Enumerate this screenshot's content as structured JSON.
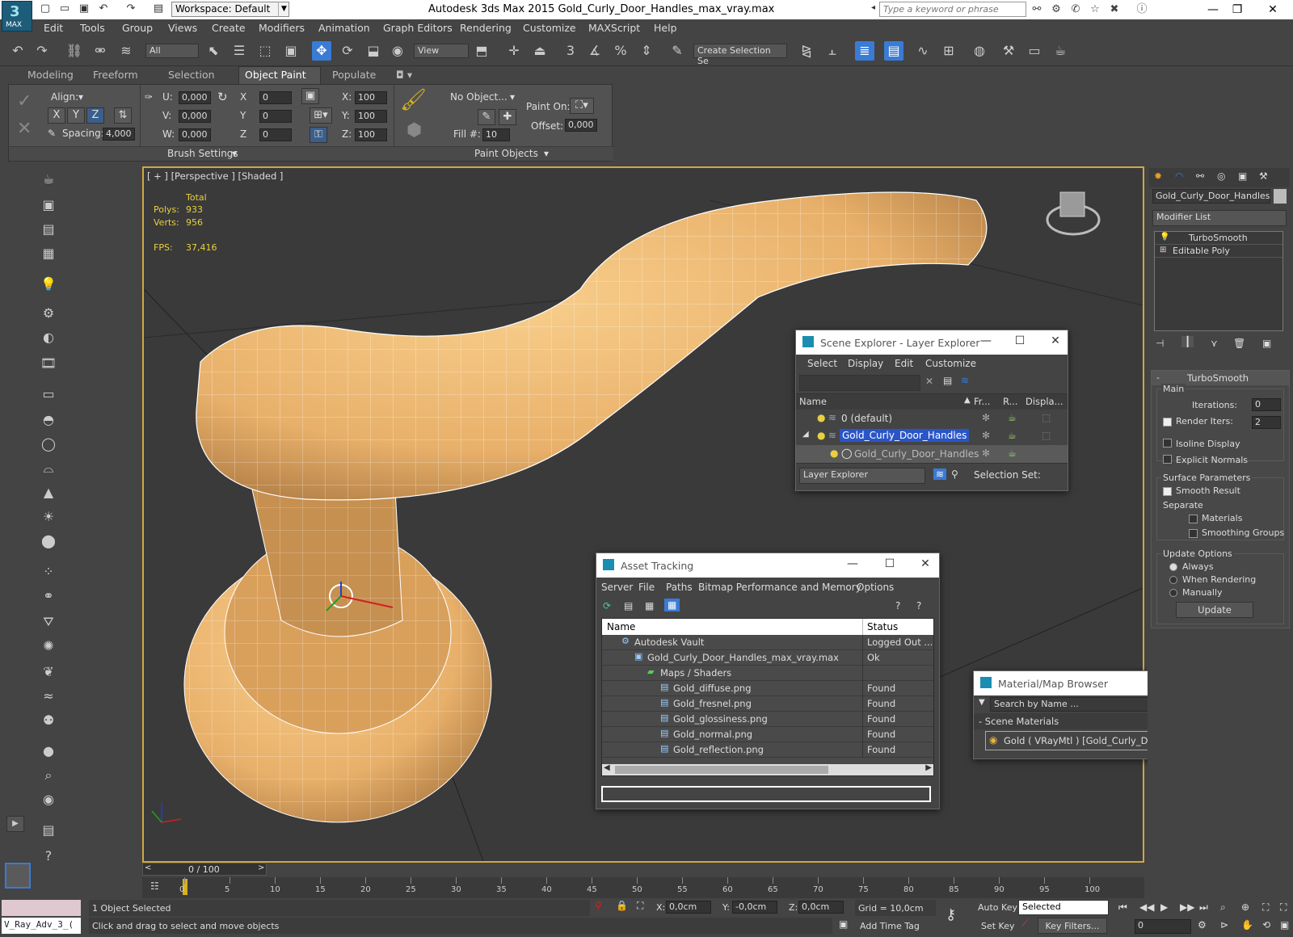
{
  "app": {
    "logo": "MAX",
    "title": "Autodesk 3ds Max  2015     Gold_Curly_Door_Handles_max_vray.max",
    "workspace": "Workspace: Default",
    "search_placeholder": "Type a keyword or phrase"
  },
  "menu": [
    "Edit",
    "Tools",
    "Group",
    "Views",
    "Create",
    "Modifiers",
    "Animation",
    "Graph Editors",
    "Rendering",
    "Customize",
    "MAXScript",
    "Help"
  ],
  "toolbar": {
    "filter": "All",
    "view": "View",
    "selection_set": "Create Selection Se",
    "snap_label": "3",
    "angle_label": "%"
  },
  "ribbon_tabs": [
    "Modeling",
    "Freeform",
    "Selection",
    "Object Paint",
    "Populate"
  ],
  "ribbon": {
    "align": "Align:",
    "spacing": "Spacing:",
    "spacing_val": "4,000",
    "axes": [
      "X",
      "Y",
      "Z"
    ],
    "u": "U:",
    "v": "V:",
    "w": "W:",
    "u_val": "0,000",
    "v_val": "0,000",
    "w_val": "0,000",
    "x": "X",
    "y": "Y",
    "z": "Z",
    "x_val": "0",
    "y_val": "0",
    "z_val": "0",
    "sx": "X:",
    "sy": "Y:",
    "sz": "Z:",
    "sx_val": "100",
    "sy_val": "100",
    "sz_val": "100",
    "no_object": "No Object...",
    "fill": "Fill #:",
    "fill_val": "10",
    "paint_on": "Paint On:",
    "offset": "Offset:",
    "offset_val": "0,000",
    "brush_settings": "Brush Settings",
    "paint_objects": "Paint Objects"
  },
  "viewport": {
    "label": "[ + ] [Perspective ] [Shaded ]",
    "total": "Total",
    "polys_label": "Polys:",
    "polys": "933",
    "verts_label": "Verts:",
    "verts": "956",
    "fps_label": "FPS:",
    "fps": "37,416"
  },
  "scene_explorer": {
    "title": "Scene Explorer - Layer Explorer",
    "menu": [
      "Select",
      "Display",
      "Edit",
      "Customize"
    ],
    "cols": [
      "Name",
      "Fr...",
      "R...",
      "Displa..."
    ],
    "rows": [
      "0 (default)",
      "Gold_Curly_Door_Handles",
      "Gold_Curly_Door_Handles"
    ],
    "footer_combo": "Layer Explorer",
    "selection_set": "Selection Set:"
  },
  "asset_tracking": {
    "title": "Asset Tracking",
    "menu": [
      "Server",
      "File",
      "Paths",
      "Bitmap Performance and Memory",
      "Options"
    ],
    "col_name": "Name",
    "col_status": "Status",
    "rows": [
      {
        "name": "Autodesk Vault",
        "status": "Logged Out ..."
      },
      {
        "name": "Gold_Curly_Door_Handles_max_vray.max",
        "status": "Ok"
      },
      {
        "name": "Maps / Shaders",
        "status": ""
      },
      {
        "name": "Gold_diffuse.png",
        "status": "Found"
      },
      {
        "name": "Gold_fresnel.png",
        "status": "Found"
      },
      {
        "name": "Gold_glossiness.png",
        "status": "Found"
      },
      {
        "name": "Gold_normal.png",
        "status": "Found"
      },
      {
        "name": "Gold_reflection.png",
        "status": "Found"
      }
    ]
  },
  "material_browser": {
    "title": "Material/Map Browser",
    "search": "Search by Name ...",
    "section": "- Scene Materials",
    "item": "Gold  ( VRayMtl ) [Gold_Curly_Door_Handles]"
  },
  "command_panel": {
    "object_name": "Gold_Curly_Door_Handles",
    "modifier_list": "Modifier List",
    "stack": [
      "TurboSmooth",
      "Editable Poly"
    ],
    "rollout": "TurboSmooth",
    "main": "Main",
    "iterations": "Iterations:",
    "iterations_val": "0",
    "render_iters": "Render Iters:",
    "render_iters_val": "2",
    "isoline": "Isoline Display",
    "explicit": "Explicit Normals",
    "surface": "Surface Parameters",
    "smooth_result": "Smooth Result",
    "separate": "Separate",
    "materials": "Materials",
    "smoothing_groups": "Smoothing Groups",
    "update_options": "Update Options",
    "always": "Always",
    "when_rendering": "When Rendering",
    "manually": "Manually",
    "update": "Update"
  },
  "timeline": {
    "frame": "0 / 100",
    "ticks": [
      "0",
      "5",
      "10",
      "15",
      "20",
      "25",
      "30",
      "35",
      "40",
      "45",
      "50",
      "55",
      "60",
      "65",
      "70",
      "75",
      "80",
      "85",
      "90",
      "95",
      "100"
    ]
  },
  "status": {
    "script": "V_Ray_Adv_3_(",
    "selected": "1 Object Selected",
    "hint": "Click and drag to select and move objects",
    "x": "X:",
    "x_val": "0,0cm",
    "y": "Y:",
    "y_val": "-0,0cm",
    "z": "Z:",
    "z_val": "0,0cm",
    "grid": "Grid = 10,0cm",
    "add_time_tag": "Add Time Tag",
    "auto_key": "Auto Key",
    "set_key": "Set Key",
    "selected_combo": "Selected",
    "key_filters": "Key Filters...",
    "frame_val": "0"
  }
}
